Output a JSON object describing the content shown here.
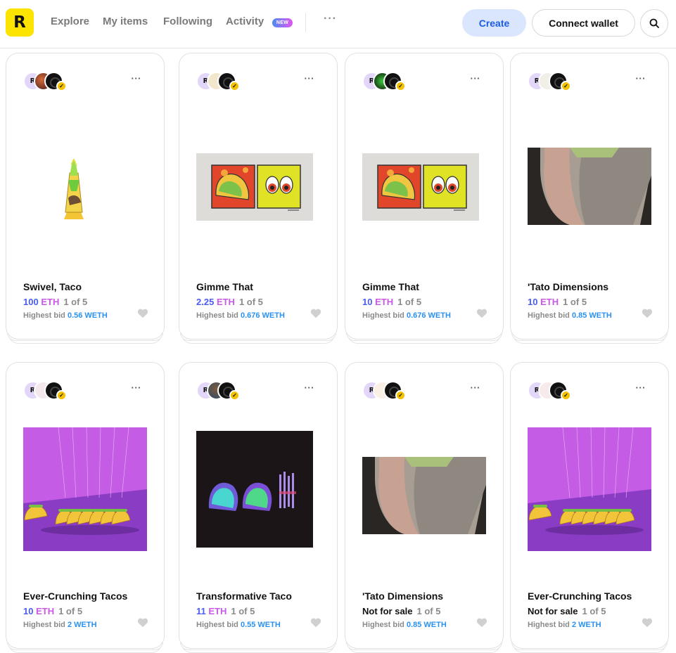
{
  "header": {
    "logo_letter": "R",
    "nav": [
      {
        "label": "Explore"
      },
      {
        "label": "My items"
      },
      {
        "label": "Following"
      },
      {
        "label": "Activity"
      }
    ],
    "new_badge": "NEW",
    "more": "···",
    "create_label": "Create",
    "wallet_label": "Connect wallet",
    "search_icon": "search-icon"
  },
  "colors": {
    "brand_yellow": "#fce300",
    "eth_blue": "#4b5cf0",
    "eth_purple": "#c85ae6",
    "weth_blue": "#2a91f0",
    "create_bg": "#d9e6fd",
    "create_text": "#1b5be6"
  },
  "cards": [
    {
      "title": "Swivel, Taco",
      "price": "100",
      "unit": "ETH",
      "edition": "1 of 5",
      "bid_label": "Highest bid",
      "bid": "0.56 WETH",
      "image": "taco-swivel"
    },
    {
      "title": "Gimme That",
      "price": "2.25",
      "unit": "ETH",
      "edition": "1 of 5",
      "bid_label": "Highest bid",
      "bid": "0.676 WETH",
      "image": "gimme-that"
    },
    {
      "title": "Gimme That",
      "price": "10",
      "unit": "ETH",
      "edition": "1 of 5",
      "bid_label": "Highest bid",
      "bid": "0.676 WETH",
      "image": "gimme-that"
    },
    {
      "title": "'Tato Dimensions",
      "price": "10",
      "unit": "ETH",
      "edition": "1 of 5",
      "bid_label": "Highest bid",
      "bid": "0.85 WETH",
      "image": "tato-dimensions"
    },
    {
      "title": "Ever-Crunching Tacos",
      "price": "10",
      "unit": "ETH",
      "edition": "1 of 5",
      "bid_label": "Highest bid",
      "bid": "2 WETH",
      "image": "ever-crunching"
    },
    {
      "title": "Transformative Taco",
      "price": "11",
      "unit": "ETH",
      "edition": "1 of 5",
      "bid_label": "Highest bid",
      "bid": "0.55 WETH",
      "image": "transformative"
    },
    {
      "title": "'Tato Dimensions",
      "not_for_sale": "Not for sale",
      "edition": "1 of 5",
      "bid_label": "Highest bid",
      "bid": "0.85 WETH",
      "image": "tato-dimensions"
    },
    {
      "title": "Ever-Crunching Tacos",
      "not_for_sale": "Not for sale",
      "edition": "1 of 5",
      "bid_label": "Highest bid",
      "bid": "2 WETH",
      "image": "ever-crunching"
    }
  ]
}
